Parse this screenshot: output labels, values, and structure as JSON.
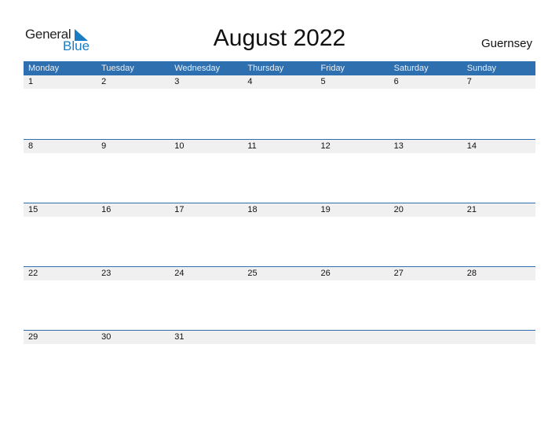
{
  "logo": {
    "general": "General",
    "blue": "Blue"
  },
  "title": "August 2022",
  "region": "Guernsey",
  "weekdays": [
    "Monday",
    "Tuesday",
    "Wednesday",
    "Thursday",
    "Friday",
    "Saturday",
    "Sunday"
  ],
  "weeks": [
    [
      "1",
      "2",
      "3",
      "4",
      "5",
      "6",
      "7"
    ],
    [
      "8",
      "9",
      "10",
      "11",
      "12",
      "13",
      "14"
    ],
    [
      "15",
      "16",
      "17",
      "18",
      "19",
      "20",
      "21"
    ],
    [
      "22",
      "23",
      "24",
      "25",
      "26",
      "27",
      "28"
    ],
    [
      "29",
      "30",
      "31",
      "",
      "",
      "",
      ""
    ]
  ],
  "colors": {
    "header": "#2e6fb0",
    "brand_blue": "#1a7dc4",
    "date_bar": "#f0f0f0"
  }
}
